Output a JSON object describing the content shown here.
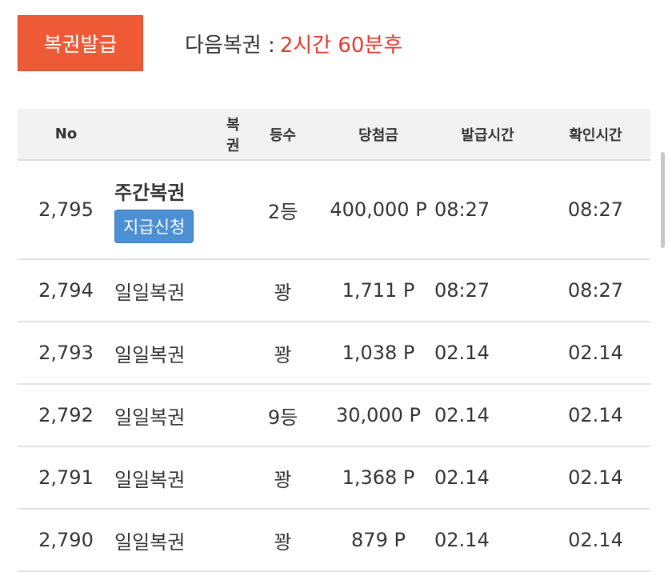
{
  "header": {
    "issue_button": "복권발급",
    "next_label": "다음복권 :",
    "next_value": "2시간 60분후"
  },
  "table": {
    "columns": [
      "No",
      "복권",
      "등수",
      "당첨금",
      "발급시간",
      "확인시간"
    ],
    "rows": [
      {
        "no": "2,795",
        "type": "주간복권",
        "rank": "2등",
        "prize": "400,000 P",
        "issued": "08:27",
        "checked": "08:27",
        "action": "지급신청"
      },
      {
        "no": "2,794",
        "type": "일일복권",
        "rank": "꽝",
        "prize": "1,711 P",
        "issued": "08:27",
        "checked": "08:27"
      },
      {
        "no": "2,793",
        "type": "일일복권",
        "rank": "꽝",
        "prize": "1,038 P",
        "issued": "02.14",
        "checked": "02.14"
      },
      {
        "no": "2,792",
        "type": "일일복권",
        "rank": "9등",
        "prize": "30,000 P",
        "issued": "02.14",
        "checked": "02.14"
      },
      {
        "no": "2,791",
        "type": "일일복권",
        "rank": "꽝",
        "prize": "1,368 P",
        "issued": "02.14",
        "checked": "02.14"
      },
      {
        "no": "2,790",
        "type": "일일복권",
        "rank": "꽝",
        "prize": "879 P",
        "issued": "02.14",
        "checked": "02.14"
      }
    ]
  },
  "colors": {
    "issue_button_bg": "#ee5a36",
    "next_value_text": "#e23b2c",
    "claim_button_bg": "#4b8fd4",
    "header_row_bg": "#f2f2f2"
  }
}
